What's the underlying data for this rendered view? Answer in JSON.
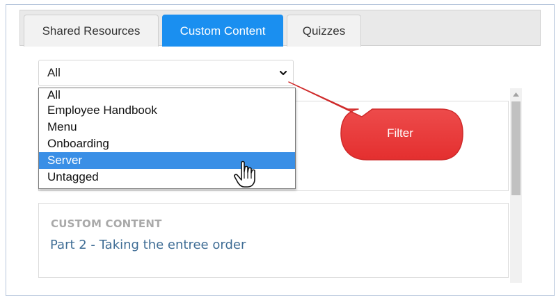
{
  "tabs": [
    {
      "label": "Shared Resources"
    },
    {
      "label": "Custom Content"
    },
    {
      "label": "Quizzes"
    }
  ],
  "filter": {
    "selected": "All",
    "options": [
      "All",
      "Employee Handbook",
      "Menu",
      "Onboarding",
      "Server",
      "Untagged"
    ],
    "highlighted": "Server"
  },
  "callout": {
    "label": "Filter"
  },
  "cards": [
    {
      "kicker": "CUSTOM CONTENT",
      "title": "Part 2 - Taking the entree order"
    }
  ],
  "colors": {
    "accent": "#1a8ff0",
    "option_highlight": "#3a8fe6",
    "callout": "#ee3b3b",
    "card_title": "#3f6d95"
  },
  "icons": {
    "select_arrow": "chevron-down-icon",
    "scroll_up": "scroll-up-arrow-icon",
    "cursor": "hand-pointer-icon"
  }
}
